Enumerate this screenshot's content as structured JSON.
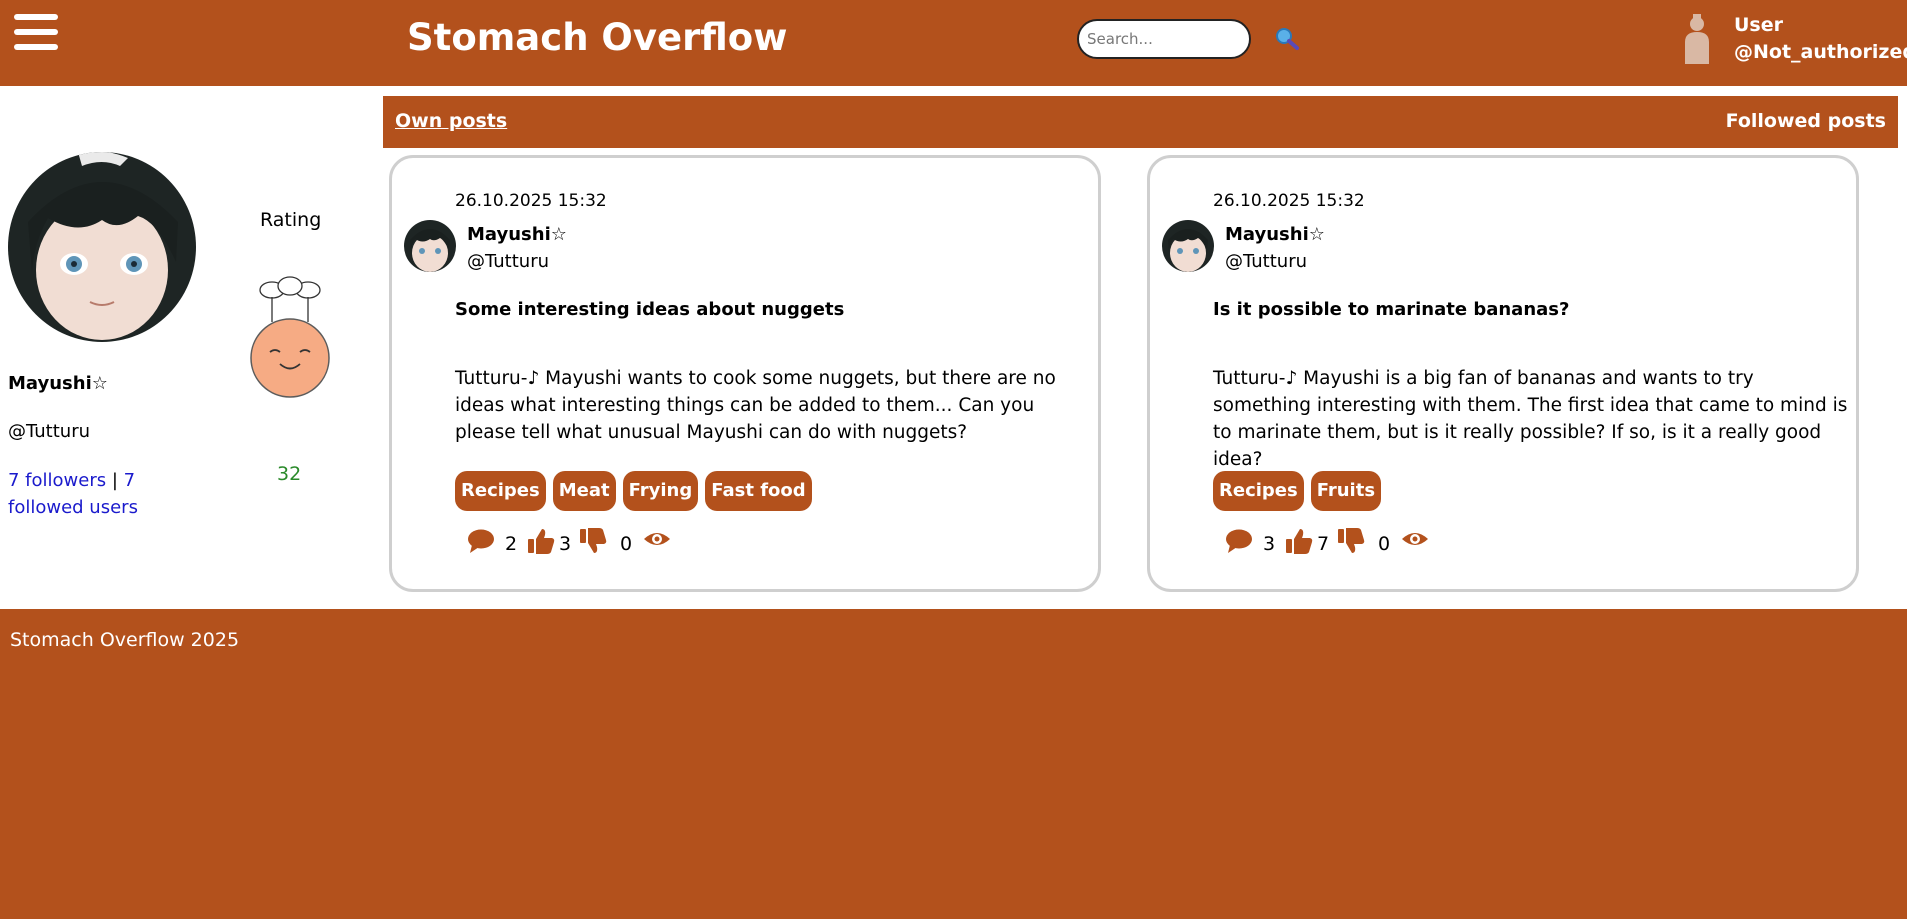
{
  "header": {
    "title": "Stomach Overflow",
    "search_placeholder": "Search...",
    "user_label": "User",
    "user_handle": "@Not_authorized"
  },
  "profile": {
    "name": "Mayushi☆",
    "handle": "@Tutturu",
    "followers": "7 followers",
    "separator": " | ",
    "followed": "7 followed users",
    "rating_label": "Rating",
    "rating_value": "32"
  },
  "tabs": {
    "own": "Own posts",
    "followed": "Followed posts"
  },
  "posts": [
    {
      "date": "26.10.2025 15:32",
      "author": "Mayushi☆",
      "handle": "@Tutturu",
      "title": "Some interesting ideas about nuggets",
      "body": "Tutturu-♪ Mayushi wants to cook some nuggets, but there are no ideas what interesting things can be added to them... Can you please tell what unusual Mayushi can do with nuggets?",
      "tags": [
        "Recipes",
        "Meat",
        "Frying",
        "Fast food"
      ],
      "comments": "2",
      "likes": "3",
      "dislikes": "0"
    },
    {
      "date": "26.10.2025 15:32",
      "author": "Mayushi☆",
      "handle": "@Tutturu",
      "title": "Is it possible to marinate bananas?",
      "body": "Tutturu-♪ Mayushi is a big fan of bananas and wants to try something interesting with them. The first idea that came to mind is to marinate them, but is it really possible? If so, is it a really good idea?",
      "tags": [
        "Recipes",
        "Fruits"
      ],
      "comments": "3",
      "likes": "7",
      "dislikes": "0"
    }
  ],
  "footer": {
    "text": "Stomach Overflow 2025"
  },
  "colors": {
    "brand": "#b3511c",
    "rating": "#2a8a2a",
    "link": "#1a1acc"
  },
  "icons": [
    "menu-icon",
    "search-icon",
    "user-icon",
    "chef-rating-icon",
    "comment-icon",
    "thumbs-up-icon",
    "thumbs-down-icon",
    "eye-icon"
  ]
}
